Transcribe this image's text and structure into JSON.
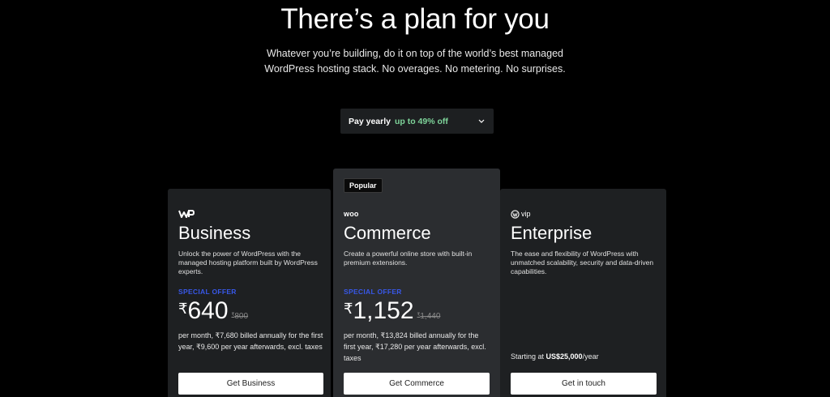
{
  "hero": {
    "title": "There’s a plan for you",
    "subtitle_line1": "Whatever you’re building, do it on top of the world’s best managed",
    "subtitle_line2": "WordPress hosting stack. No overages. No metering. No surprises."
  },
  "billing": {
    "label": "Pay yearly",
    "discount": "up to 49% off",
    "icon": "chevron-down-icon"
  },
  "colors": {
    "background": "#000000",
    "card": "#1e2022",
    "card_highlight": "#2b2d30",
    "special_offer": "#3858e9",
    "discount_green": "#7ed49a"
  },
  "plans": [
    {
      "logo_text": "WP",
      "logo_icon": "wp-logo-icon",
      "name": "Business",
      "description": "Unlock the power of WordPress with the managed hosting platform built by WordPress experts.",
      "special_offer": "SPECIAL OFFER",
      "currency": "₹",
      "price": "640",
      "old_currency": "₹",
      "old_price": "800",
      "billing_note": "per month, ₹7,680 billed annually for the first year, ₹9,600 per year afterwards, excl. taxes",
      "cta": "Get Business"
    },
    {
      "badge": "Popular",
      "logo_text": "woo",
      "logo_icon": "woo-logo-icon",
      "name": "Commerce",
      "description": "Create a powerful online store with built-in premium extensions.",
      "special_offer": "SPECIAL OFFER",
      "currency": "₹",
      "price": "1,152",
      "old_currency": "₹",
      "old_price": "1,440",
      "billing_note": "per month, ₹13,824 billed annually for the first year, ₹17,280 per year afterwards, excl. taxes",
      "cta": "Get Commerce"
    },
    {
      "logo_text": "vip",
      "logo_icon": "wordpress-vip-logo-icon",
      "name": "Enterprise",
      "description": "The ease and flexibility of WordPress with unmatched scalability, security and data-driven capabilities.",
      "starting_prefix": "Starting at",
      "starting_price": "US$25,000",
      "starting_suffix": "/year",
      "cta": "Get in touch"
    }
  ]
}
